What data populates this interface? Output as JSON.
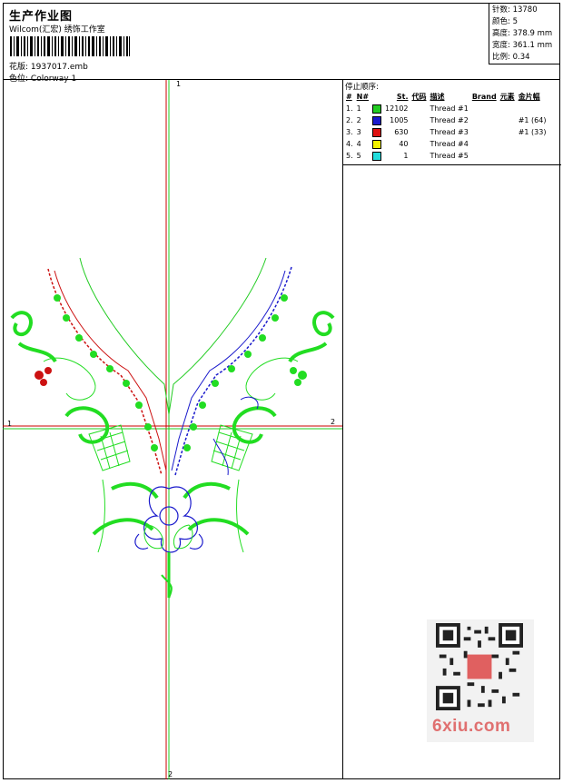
{
  "header": {
    "title": "生产作业图",
    "company": "Wilcom(汇宏) 绣饰工作室",
    "design_label": "花版:",
    "design_file": "1937017.emb",
    "colorway_label": "色位:",
    "colorway": "Colorway 1"
  },
  "stats": {
    "stitches_label": "针数:",
    "stitches": "13780",
    "colors_label": "颜色:",
    "colors": "5",
    "height_label": "高度:",
    "height": "378.9 mm",
    "width_label": "宽度:",
    "width": "361.1 mm",
    "scale_label": "比例:",
    "scale": "0.34"
  },
  "stop_sequence": {
    "title": "停止顺序:",
    "headers": [
      "#",
      "N#",
      "St.",
      "代码",
      "描述",
      "Brand",
      "元素",
      "金片幅"
    ],
    "rows": [
      {
        "idx": "1.",
        "n": "1",
        "color": "#22cc22",
        "st": "12102",
        "code": "",
        "desc": "Thread #1",
        "brand": "",
        "element": "",
        "sequin": ""
      },
      {
        "idx": "2.",
        "n": "2",
        "color": "#1a1acc",
        "st": "1005",
        "code": "",
        "desc": "Thread #2",
        "brand": "",
        "element": "",
        "sequin": "#1 (64)"
      },
      {
        "idx": "3.",
        "n": "3",
        "color": "#dd1111",
        "st": "630",
        "code": "",
        "desc": "Thread #3",
        "brand": "",
        "element": "",
        "sequin": "#1 (33)"
      },
      {
        "idx": "4.",
        "n": "4",
        "color": "#f2f200",
        "st": "40",
        "code": "",
        "desc": "Thread #4",
        "brand": "",
        "element": "",
        "sequin": ""
      },
      {
        "idx": "5.",
        "n": "5",
        "color": "#22dddd",
        "st": "1",
        "code": "",
        "desc": "Thread #5",
        "brand": "",
        "element": "",
        "sequin": ""
      }
    ]
  },
  "axes": {
    "v_top": "1",
    "v_bottom": "2",
    "h_left": "1",
    "h_right": "2"
  },
  "watermark": {
    "site": "6xiu.com",
    "stamp": "刺绣图库"
  },
  "colors": {
    "green": "#22dd22",
    "blue": "#1a1acc",
    "red": "#cc1111",
    "axis_red": "#cc0000"
  }
}
